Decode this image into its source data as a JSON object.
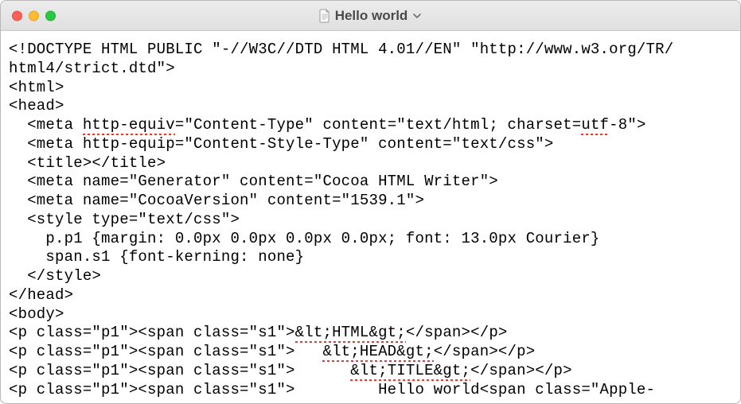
{
  "window": {
    "title": "Hello world"
  },
  "code": {
    "lines": [
      [
        {
          "t": "<!DOCTYPE HTML PUBLIC \"-//W3C//DTD HTML 4.01//EN\" \"http://www.w3.org/TR/"
        }
      ],
      [
        {
          "t": "html4/strict.dtd\">"
        }
      ],
      [
        {
          "t": "<html>"
        }
      ],
      [
        {
          "t": "<head>"
        }
      ],
      [
        {
          "t": "  <meta "
        },
        {
          "t": "http-equiv",
          "spell": true
        },
        {
          "t": "=\"Content-Type\" content=\"text/html; charset="
        },
        {
          "t": "utf",
          "spell": true
        },
        {
          "t": "-8\">"
        }
      ],
      [
        {
          "t": "  <meta http-equip=\"Content-Style-Type\" content=\"text/css\">"
        }
      ],
      [
        {
          "t": "  <title></title>"
        }
      ],
      [
        {
          "t": "  <meta name=\"Generator\" content=\"Cocoa HTML Writer\">"
        }
      ],
      [
        {
          "t": "  <meta name=\"CocoaVersion\" content=\"1539.1\">"
        }
      ],
      [
        {
          "t": "  <style type=\"text/css\">"
        }
      ],
      [
        {
          "t": "    p.p1 {margin: 0.0px 0.0px 0.0px 0.0px; font: 13.0px Courier}"
        }
      ],
      [
        {
          "t": "    span.s1 {font-kerning: none}"
        }
      ],
      [
        {
          "t": "  </style>"
        }
      ],
      [
        {
          "t": "</head>"
        }
      ],
      [
        {
          "t": "<body>"
        }
      ],
      [
        {
          "t": "<p class=\"p1\"><span class=\"s1\">"
        },
        {
          "t": "&lt;HTML&gt;",
          "spell": true
        },
        {
          "t": "</span></p>"
        }
      ],
      [
        {
          "t": "<p class=\"p1\"><span class=\"s1\">   "
        },
        {
          "t": "&lt;HEAD&gt;",
          "spell": true
        },
        {
          "t": "</span></p>"
        }
      ],
      [
        {
          "t": "<p class=\"p1\"><span class=\"s1\">      "
        },
        {
          "t": "&lt;TITLE&gt;",
          "spell": true
        },
        {
          "t": "</span></p>"
        }
      ],
      [
        {
          "t": "<p class=\"p1\"><span class=\"s1\">         Hello world<span class=\"Apple-"
        }
      ]
    ]
  }
}
